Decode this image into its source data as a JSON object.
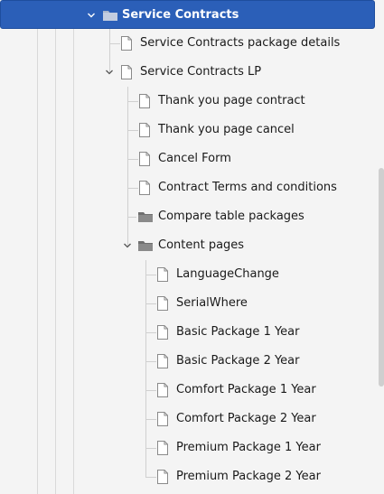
{
  "tree": {
    "root": {
      "label": "Service Contracts",
      "icon": "folder-icon",
      "expanded": true,
      "selected": true
    },
    "items": [
      {
        "label": "Service Contracts package details",
        "icon": "page-icon"
      },
      {
        "label": "Service Contracts LP",
        "icon": "page-icon",
        "expanded": true
      },
      {
        "label": "Thank you page contract",
        "icon": "page-icon"
      },
      {
        "label": "Thank you page cancel",
        "icon": "page-icon"
      },
      {
        "label": "Cancel Form",
        "icon": "page-icon"
      },
      {
        "label": "Contract Terms and conditions",
        "icon": "page-icon"
      },
      {
        "label": "Compare table packages",
        "icon": "folder-icon"
      },
      {
        "label": "Content pages",
        "icon": "folder-icon",
        "expanded": true
      },
      {
        "label": "LanguageChange",
        "icon": "page-icon"
      },
      {
        "label": "SerialWhere",
        "icon": "page-icon"
      },
      {
        "label": "Basic Package 1 Year",
        "icon": "page-icon"
      },
      {
        "label": "Basic Package 2 Year",
        "icon": "page-icon"
      },
      {
        "label": "Comfort Package 1 Year",
        "icon": "page-icon"
      },
      {
        "label": "Comfort Package 2 Year",
        "icon": "page-icon"
      },
      {
        "label": "Premium Package 1 Year",
        "icon": "page-icon"
      },
      {
        "label": "Premium Package 2 Year",
        "icon": "page-icon"
      }
    ]
  },
  "colors": {
    "selection": "#2b5fb8",
    "background": "#f4f4f4",
    "folder": "#8a8a8a"
  }
}
